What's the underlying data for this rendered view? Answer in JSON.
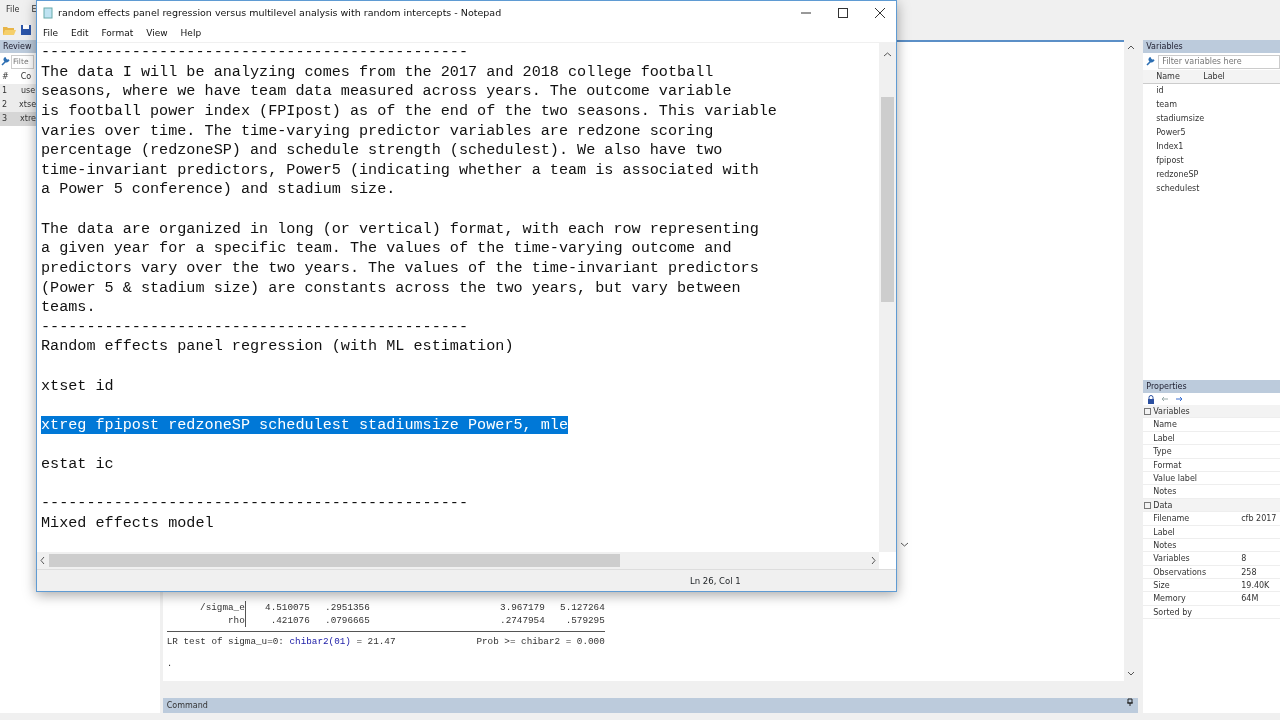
{
  "stata": {
    "menu": [
      "File",
      "E"
    ],
    "review": {
      "title": "Review",
      "filter_placeholder": "Filte",
      "columns": [
        "#",
        "Co"
      ],
      "rows": [
        {
          "number": "1",
          "command": "use",
          "selected": false
        },
        {
          "number": "2",
          "command": "xtse",
          "selected": false
        },
        {
          "number": "3",
          "command": "xtre",
          "selected": true
        }
      ]
    },
    "results": {
      "table_rows": [
        {
          "label": "/sigma_e",
          "values": [
            "4.510075",
            ".2951356",
            "3.967179",
            "5.127264"
          ]
        },
        {
          "label": "rho",
          "values": [
            ".421076",
            ".0796665",
            ".2747954",
            ".579295"
          ]
        }
      ],
      "lr_test": [
        {
          "text": "LR test of sigma_u=0: ",
          "kind": "plain"
        },
        {
          "text": "chibar2(01)",
          "kind": "link"
        },
        {
          "text": " = 21.47",
          "kind": "plain"
        }
      ],
      "prob": "Prob >= chibar2 = 0.000",
      "prompt": "."
    },
    "command": {
      "title": "Command"
    },
    "variables": {
      "title": "Variables",
      "filter_placeholder": "Filter variables here",
      "columns": [
        "Name",
        "Label"
      ],
      "names": [
        "id",
        "team",
        "stadiumsize",
        "Power5",
        "Index1",
        "fpipost",
        "redzoneSP",
        "schedulest"
      ]
    },
    "properties": {
      "title": "Properties",
      "groups": [
        {
          "title": "Variables",
          "rows": [
            {
              "name": "Name"
            },
            {
              "name": "Label"
            },
            {
              "name": "Type"
            },
            {
              "name": "Format"
            },
            {
              "name": "Value label"
            },
            {
              "name": "Notes"
            }
          ]
        },
        {
          "title": "Data",
          "rows": [
            {
              "name": "Filename",
              "value": "cfb 2017"
            },
            {
              "name": "Label"
            },
            {
              "name": "Notes"
            },
            {
              "name": "Variables",
              "value": "8"
            },
            {
              "name": "Observations",
              "value": "258"
            },
            {
              "name": "Size",
              "value": "19.40K"
            },
            {
              "name": "Memory",
              "value": "64M"
            },
            {
              "name": "Sorted by"
            }
          ]
        }
      ]
    }
  },
  "notepad": {
    "title": "random effects panel regression versus multilevel analysis with random intercepts - Notepad",
    "menu": [
      "File",
      "Edit",
      "Format",
      "View",
      "Help"
    ],
    "lines": [
      {
        "kind": "text",
        "text": "-----------------------------------------------",
        "selected": false
      },
      {
        "kind": "text",
        "text": "The data I will be analyzing comes from the 2017 and 2018 college football",
        "selected": false
      },
      {
        "kind": "text",
        "text": "seasons, where we have team data measured across years. The outcome variable",
        "selected": false
      },
      {
        "kind": "text",
        "text": "is football power index (FPIpost) as of the end of the two seasons. This variable",
        "selected": false
      },
      {
        "kind": "text",
        "text": "varies over time. The time-varying predictor variables are redzone scoring",
        "selected": false
      },
      {
        "kind": "text",
        "text": "percentage (redzoneSP) and schedule strength (schedulest). We also have two",
        "selected": false
      },
      {
        "kind": "text",
        "text": "time-invariant predictors, Power5 (indicating whether a team is associated with",
        "selected": false
      },
      {
        "kind": "text",
        "text": "a Power 5 conference) and stadium size.",
        "selected": false
      },
      {
        "kind": "blank"
      },
      {
        "kind": "text",
        "text": "The data are organized in long (or vertical) format, with each row representing",
        "selected": false
      },
      {
        "kind": "text",
        "text": "a given year for a specific team. The values of the time-varying outcome and",
        "selected": false
      },
      {
        "kind": "text",
        "text": "predictors vary over the two years. The values of the time-invariant predictors",
        "selected": false
      },
      {
        "kind": "text",
        "text": "(Power 5 & stadium size) are constants across the two years, but vary between",
        "selected": false
      },
      {
        "kind": "text",
        "text": "teams.",
        "selected": false
      },
      {
        "kind": "text",
        "text": "-----------------------------------------------",
        "selected": false
      },
      {
        "kind": "text",
        "text": "Random effects panel regression (with ML estimation)",
        "selected": false
      },
      {
        "kind": "blank"
      },
      {
        "kind": "text",
        "text": "xtset id",
        "selected": false
      },
      {
        "kind": "blank"
      },
      {
        "kind": "text",
        "text": "xtreg fpipost redzoneSP schedulest stadiumsize Power5, mle",
        "selected": true
      },
      {
        "kind": "blank"
      },
      {
        "kind": "text",
        "text": "estat ic",
        "selected": false
      },
      {
        "kind": "blank"
      },
      {
        "kind": "text",
        "text": "-----------------------------------------------",
        "selected": false
      },
      {
        "kind": "text",
        "text": "Mixed effects model",
        "selected": false
      }
    ],
    "status": "Ln 26, Col 1"
  }
}
